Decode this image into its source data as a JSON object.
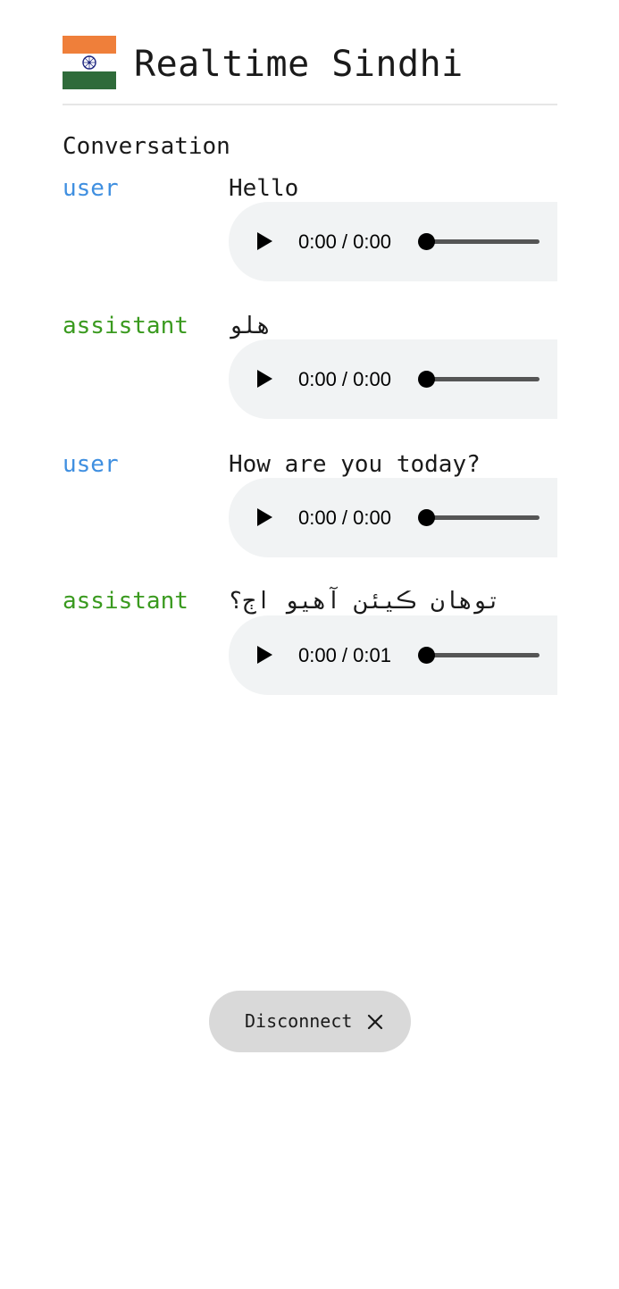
{
  "header": {
    "title": "Realtime Sindhi",
    "flag_icon": "india-flag-icon",
    "flag_colors": {
      "saffron": "#ef7f3a",
      "white": "#ffffff",
      "green": "#2f6b3a",
      "chakra": "#1a237e"
    }
  },
  "conversation": {
    "title": "Conversation",
    "messages": [
      {
        "role": "user",
        "role_color": "#3f8fe0",
        "text": "Hello",
        "rtl": false,
        "audio": {
          "time": "0:00 / 0:00",
          "progress": 0
        }
      },
      {
        "role": "assistant",
        "role_color": "#3a9a1f",
        "text": "هلو",
        "rtl": true,
        "audio": {
          "time": "0:00 / 0:00",
          "progress": 0
        }
      },
      {
        "role": "user",
        "role_color": "#3f8fe0",
        "text": "How are you today?",
        "rtl": false,
        "audio": {
          "time": "0:00 / 0:00",
          "progress": 0
        }
      },
      {
        "role": "assistant",
        "role_color": "#3a9a1f",
        "text": "توهان ڪيئن آهيو اڄ؟",
        "rtl": true,
        "audio": {
          "time": "0:00 / 0:01",
          "progress": 0
        }
      }
    ]
  },
  "controls": {
    "disconnect_label": "Disconnect",
    "disconnect_icon": "close-icon"
  },
  "icons": {
    "play": "play-icon",
    "seek": "seek-slider"
  }
}
